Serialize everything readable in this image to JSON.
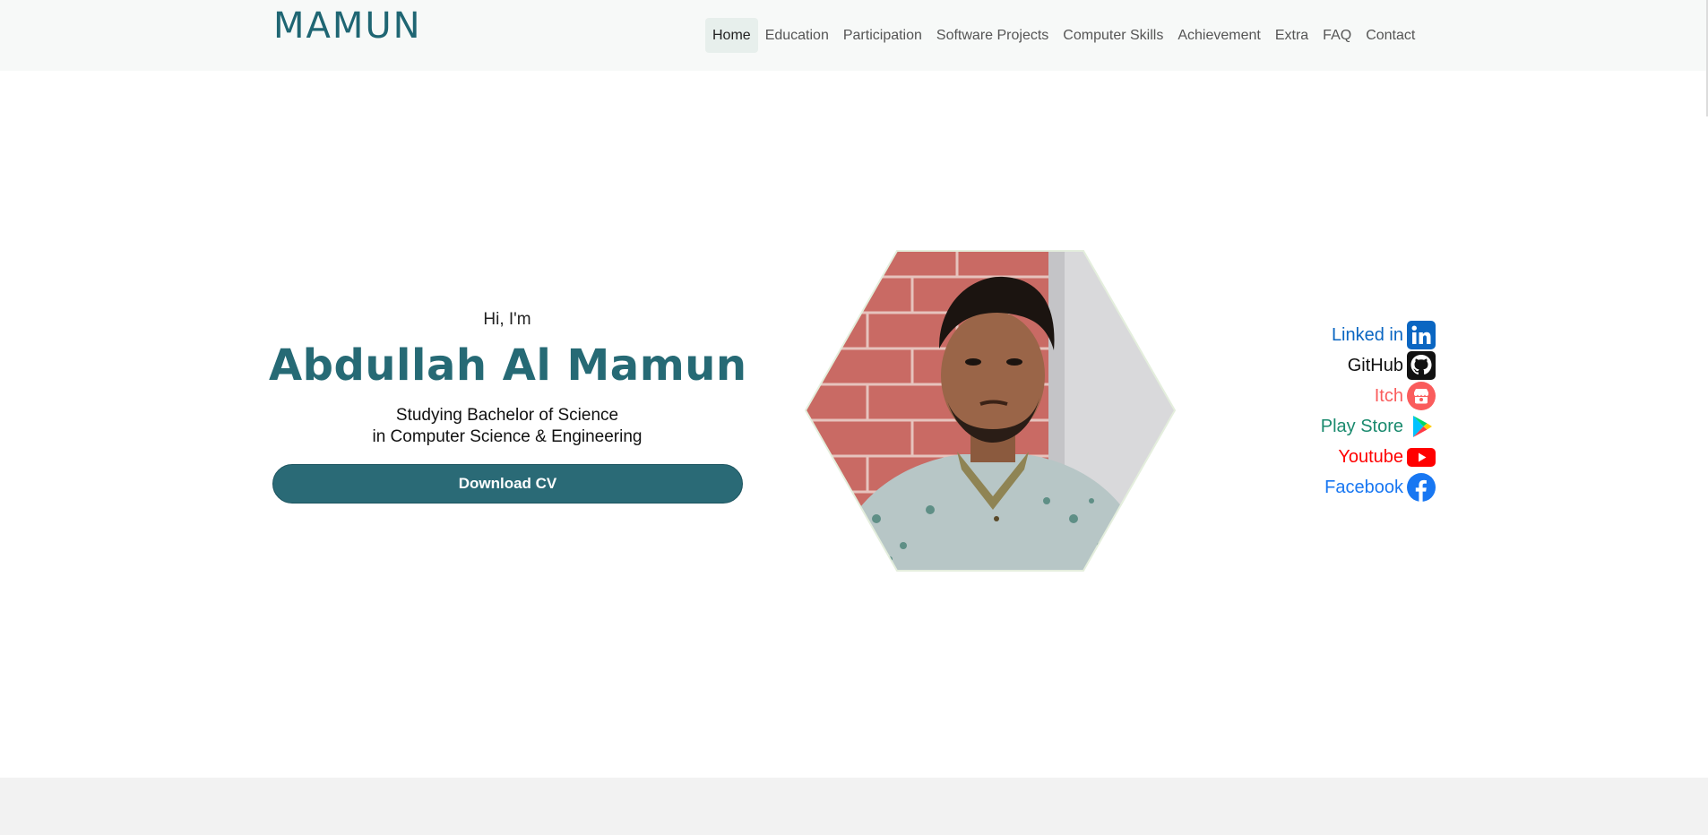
{
  "brand": {
    "text": "MAMUN"
  },
  "nav": {
    "items": [
      {
        "label": "Home",
        "active": true
      },
      {
        "label": "Education"
      },
      {
        "label": "Participation"
      },
      {
        "label": "Software Projects"
      },
      {
        "label": "Computer Skills"
      },
      {
        "label": "Achievement"
      },
      {
        "label": "Extra"
      },
      {
        "label": "FAQ"
      },
      {
        "label": "Contact"
      }
    ]
  },
  "hero": {
    "greeting": "Hi, I'm",
    "name": "Abdullah Al Mamun",
    "study_line1": "Studying Bachelor of Science",
    "study_line2": "in Computer Science & Engineering",
    "cv_button": "Download CV"
  },
  "social": {
    "links": [
      {
        "label": "Linked in",
        "icon": "linkedin-icon",
        "color": "#0a66c2"
      },
      {
        "label": "GitHub",
        "icon": "github-icon",
        "color": "#111111"
      },
      {
        "label": "Itch",
        "icon": "itch-icon",
        "color": "#fa5c5c"
      },
      {
        "label": "Play Store",
        "icon": "play-store-icon",
        "color": "#1a8a6e"
      },
      {
        "label": "Youtube",
        "icon": "youtube-icon",
        "color": "#ff0000"
      },
      {
        "label": "Facebook",
        "icon": "facebook-icon",
        "color": "#1877f2"
      }
    ]
  },
  "colors": {
    "accent": "#266a75",
    "nav_bg": "#f7f9f8",
    "active_nav_bg": "#e7efec",
    "footer_bg": "#f2f2f2"
  }
}
